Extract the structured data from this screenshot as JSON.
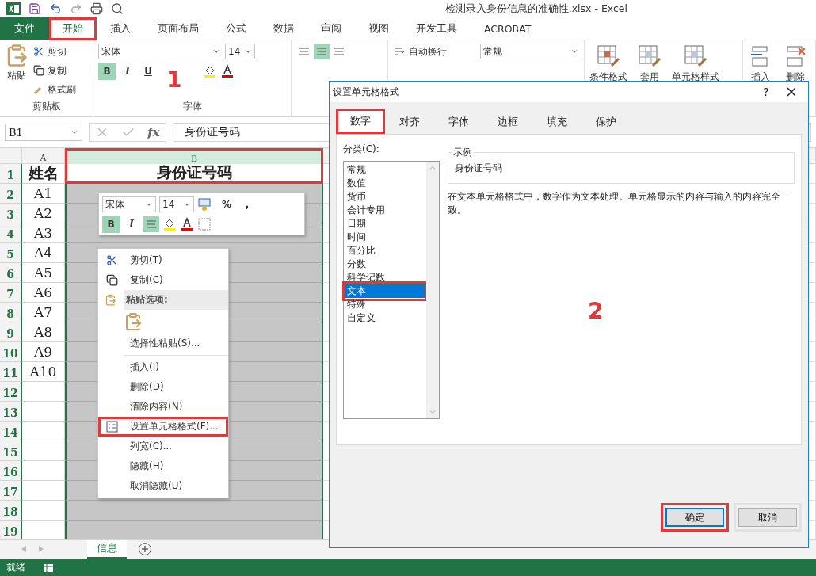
{
  "title_bar": {
    "title": "检测录入身份信息的准确性.xlsx - Excel"
  },
  "ribbon_tabs": [
    {
      "label": "文件",
      "kind": "file",
      "selected": false,
      "highlighted": false
    },
    {
      "label": "开始",
      "kind": "tab",
      "selected": true,
      "highlighted": true
    },
    {
      "label": "插入",
      "kind": "tab",
      "selected": false,
      "highlighted": false
    },
    {
      "label": "页面布局",
      "kind": "tab",
      "selected": false,
      "highlighted": false
    },
    {
      "label": "公式",
      "kind": "tab",
      "selected": false,
      "highlighted": false
    },
    {
      "label": "数据",
      "kind": "tab",
      "selected": false,
      "highlighted": false
    },
    {
      "label": "审阅",
      "kind": "tab",
      "selected": false,
      "highlighted": false
    },
    {
      "label": "视图",
      "kind": "tab",
      "selected": false,
      "highlighted": false
    },
    {
      "label": "开发工具",
      "kind": "tab",
      "selected": false,
      "highlighted": false
    },
    {
      "label": "ACROBAT",
      "kind": "tab",
      "selected": false,
      "highlighted": false
    }
  ],
  "ribbon": {
    "clipboard": {
      "paste": "粘贴",
      "cut": "剪切",
      "copy": "复制",
      "format_painter": "格式刷",
      "group_label": "剪贴板"
    },
    "font": {
      "font_name": "宋体",
      "font_size": "14",
      "bold": {
        "label": "B",
        "active": true
      },
      "italic": {
        "label": "I",
        "active": false
      },
      "underline": {
        "label": "U",
        "active": false
      },
      "group_label": "字体"
    },
    "alignment": {
      "wrap_text": "自动换行"
    },
    "number": {
      "format": "常规"
    },
    "styles": [
      "条件格式",
      "套用",
      "单元格样式"
    ],
    "cells": [
      "插入",
      "删除"
    ]
  },
  "formula_bar": {
    "name_box": "B1",
    "fx": "fx",
    "value": "身份证号码"
  },
  "sheet": {
    "columns": [
      {
        "label": "A",
        "selected": false,
        "highlighted": false
      },
      {
        "label": "B",
        "selected": true,
        "highlighted": true
      }
    ],
    "rows": [
      {
        "number": "1",
        "cells": [
          "姓名",
          "身份证号码"
        ]
      },
      {
        "number": "2",
        "cells": [
          "A1"
        ]
      },
      {
        "number": "3",
        "cells": [
          "A2"
        ]
      },
      {
        "number": "4",
        "cells": [
          "A3"
        ]
      },
      {
        "number": "5",
        "cells": [
          "A4"
        ]
      },
      {
        "number": "6",
        "cells": [
          "A5"
        ]
      },
      {
        "number": "7",
        "cells": [
          "A6"
        ]
      },
      {
        "number": "8",
        "cells": [
          "A7"
        ]
      },
      {
        "number": "9",
        "cells": [
          "A8"
        ]
      },
      {
        "number": "10",
        "cells": [
          "A9"
        ]
      },
      {
        "number": "11",
        "cells": [
          "A10"
        ]
      },
      {
        "number": "12"
      },
      {
        "number": "13"
      },
      {
        "number": "14"
      },
      {
        "number": "15"
      },
      {
        "number": "16"
      },
      {
        "number": "17"
      },
      {
        "number": "18"
      },
      {
        "number": "19"
      }
    ]
  },
  "mini_toolbar": {
    "font_name": "宋体",
    "font_size": "14",
    "bold": {
      "label": "B",
      "active": true
    },
    "italic": {
      "label": "I",
      "active": false
    },
    "center_active": true,
    "percent": "%",
    "comma": ","
  },
  "context_menu": [
    {
      "kind": "cut",
      "label": "剪切(T)",
      "highlighted": false
    },
    {
      "kind": "copy",
      "label": "复制(C)",
      "highlighted": false
    },
    {
      "kind": "header",
      "label": "粘贴选项:",
      "highlighted": false
    },
    {
      "kind": "paste_option"
    },
    {
      "kind": "item",
      "label": "选择性粘贴(S)...",
      "highlighted": false
    },
    {
      "kind": "separator"
    },
    {
      "kind": "item",
      "label": "插入(I)",
      "highlighted": false
    },
    {
      "kind": "item",
      "label": "删除(D)",
      "highlighted": false
    },
    {
      "kind": "item",
      "label": "清除内容(N)",
      "highlighted": false
    },
    {
      "kind": "format",
      "label": "设置单元格格式(F)...",
      "highlighted": true
    },
    {
      "kind": "item",
      "label": "列宽(C)...",
      "highlighted": false
    },
    {
      "kind": "item",
      "label": "隐藏(H)",
      "highlighted": false
    },
    {
      "kind": "item",
      "label": "取消隐藏(U)",
      "highlighted": false
    }
  ],
  "dialog": {
    "title": "设置单元格格式",
    "help": "?",
    "tabs": [
      {
        "label": "数字",
        "selected": true,
        "highlighted": true
      },
      {
        "label": "对齐",
        "selected": false,
        "highlighted": false
      },
      {
        "label": "字体",
        "selected": false,
        "highlighted": false
      },
      {
        "label": "边框",
        "selected": false,
        "highlighted": false
      },
      {
        "label": "填充",
        "selected": false,
        "highlighted": false
      },
      {
        "label": "保护",
        "selected": false,
        "highlighted": false
      }
    ],
    "category_label": "分类(C):",
    "categories": [
      {
        "label": "常规",
        "selected": false,
        "highlighted": false
      },
      {
        "label": "数值",
        "selected": false,
        "highlighted": false
      },
      {
        "label": "货币",
        "selected": false,
        "highlighted": false
      },
      {
        "label": "会计专用",
        "selected": false,
        "highlighted": false
      },
      {
        "label": "日期",
        "selected": false,
        "highlighted": false
      },
      {
        "label": "时间",
        "selected": false,
        "highlighted": false
      },
      {
        "label": "百分比",
        "selected": false,
        "highlighted": false
      },
      {
        "label": "分数",
        "selected": false,
        "highlighted": false
      },
      {
        "label": "科学记数",
        "selected": false,
        "highlighted": false
      },
      {
        "label": "文本",
        "selected": true,
        "highlighted": true
      },
      {
        "label": "特殊",
        "selected": false,
        "highlighted": false
      },
      {
        "label": "自定义",
        "selected": false,
        "highlighted": false
      }
    ],
    "sample_label": "示例",
    "sample_value": "身份证号码",
    "description": "在文本单元格格式中，数字作为文本处理。单元格显示的内容与输入的内容完全一致。",
    "buttons": [
      {
        "label": "确定",
        "default": true,
        "highlighted": true
      },
      {
        "label": "取消",
        "default": false,
        "highlighted": false
      }
    ]
  },
  "annotations": [
    "1",
    "2"
  ],
  "sheet_tabs": [
    {
      "label": "信息",
      "selected": true
    }
  ],
  "status_bar": {
    "status": "就绪"
  }
}
